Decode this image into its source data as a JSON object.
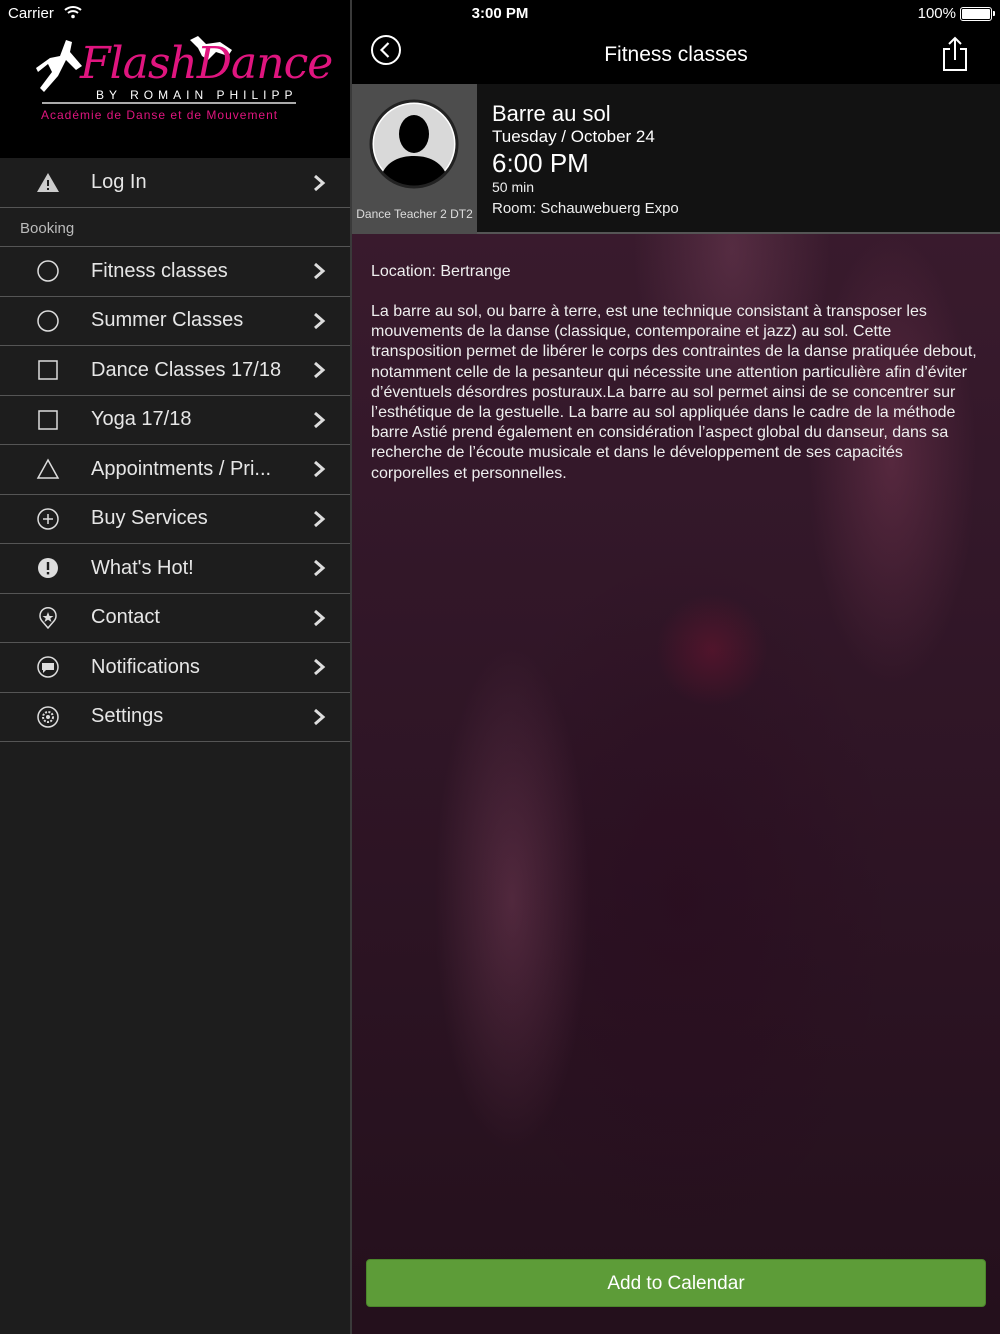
{
  "status_bar": {
    "carrier": "Carrier",
    "time": "3:00 PM",
    "battery": "100%"
  },
  "logo": {
    "main": "FlashDance",
    "by": "BY ROMAIN PHILIPP",
    "sub": "Académie de Danse et de Mouvement"
  },
  "sidebar": {
    "login": {
      "label": "Log In",
      "icon": "warning-icon"
    },
    "section_label": "Booking",
    "items": [
      {
        "label": "Fitness classes",
        "icon": "circle-icon"
      },
      {
        "label": "Summer Classes",
        "icon": "circle-icon"
      },
      {
        "label": "Dance Classes 17/18",
        "icon": "square-icon"
      },
      {
        "label": "Yoga 17/18",
        "icon": "square-icon"
      },
      {
        "label": "Appointments / Pri...",
        "icon": "triangle-icon"
      },
      {
        "label": "Buy Services",
        "icon": "plus-circle-icon"
      },
      {
        "label": "What's Hot!",
        "icon": "exclamation-icon"
      },
      {
        "label": "Contact",
        "icon": "location-pin-icon"
      },
      {
        "label": "Notifications",
        "icon": "chat-bubble-icon"
      },
      {
        "label": "Settings",
        "icon": "gear-icon"
      }
    ]
  },
  "navbar": {
    "title": "Fitness classes"
  },
  "class": {
    "teacher": "Dance Teacher 2 DT2",
    "title": "Barre au sol",
    "date": "Tuesday / October 24",
    "time": "6:00 PM",
    "duration": "50 min",
    "room": "Room: Schauwebuerg Expo",
    "location": "Location: Bertrange",
    "description": "La barre au sol, ou barre à terre, est une technique consistant à transposer les mouvements de la danse (classique, contemporaine et jazz) au sol. Cette transposition permet de libérer le corps des contraintes de la danse pratiquée debout, notamment celle de la pesanteur qui nécessite une attention particulière afin d’éviter d’éventuels désordres posturaux.La barre au sol permet ainsi de se concentrer sur l’esthétique de la gestuelle. La barre au sol appliquée dans le cadre de la méthode barre Astié prend également en considération l’aspect global du danseur, dans sa recherche de l’écoute musicale et dans le développement de ses capacités corporelles et personnelles."
  },
  "actions": {
    "add_to_calendar": "Add to Calendar"
  },
  "colors": {
    "accent_pink": "#e0157f",
    "button_green": "#5d9c38"
  }
}
